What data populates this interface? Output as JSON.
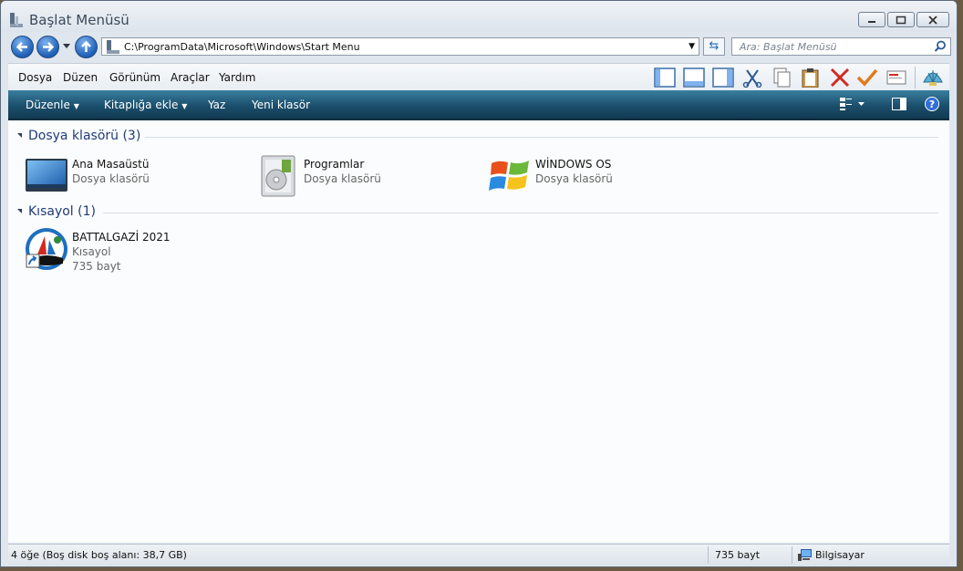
{
  "window": {
    "title": "Başlat Menüsü"
  },
  "address": {
    "path": "C:\\ProgramData\\Microsoft\\Windows\\Start Menu",
    "search_placeholder": "Ara: Başlat Menüsü"
  },
  "menu": {
    "items": [
      "Dosya",
      "Düzen",
      "Görünüm",
      "Araçlar",
      "Yardım"
    ]
  },
  "commands": {
    "organize": "Düzenle",
    "add_to_library": "Kitaplığa ekle",
    "print": "Yaz",
    "new_folder": "Yeni klasör"
  },
  "groups": [
    {
      "header": "Dosya klasörü (3)",
      "items": [
        {
          "name": "Ana Masaüstü",
          "type": "Dosya klasörü",
          "icon": "desktop-icon"
        },
        {
          "name": "Programlar",
          "type": "Dosya klasörü",
          "icon": "programs-folder-icon"
        },
        {
          "name": "WİNDOWS OS",
          "type": "Dosya klasörü",
          "icon": "windows-logo-icon"
        }
      ]
    },
    {
      "header": "Kısayol (1)",
      "items": [
        {
          "name": "BATTALGAZİ 2021",
          "type": "Kısayol",
          "size": "735 bayt",
          "icon": "shortcut-app-icon"
        }
      ]
    }
  ],
  "status": {
    "items_info": "4 öğe (Boş disk boş alanı: 38,7 GB)",
    "selection_size": "735 bayt",
    "location": "Bilgisayar"
  },
  "colors": {
    "command_bar": "#1b4f6c",
    "group_header": "#1f3b78",
    "nav_button": "#1d5fb6"
  }
}
